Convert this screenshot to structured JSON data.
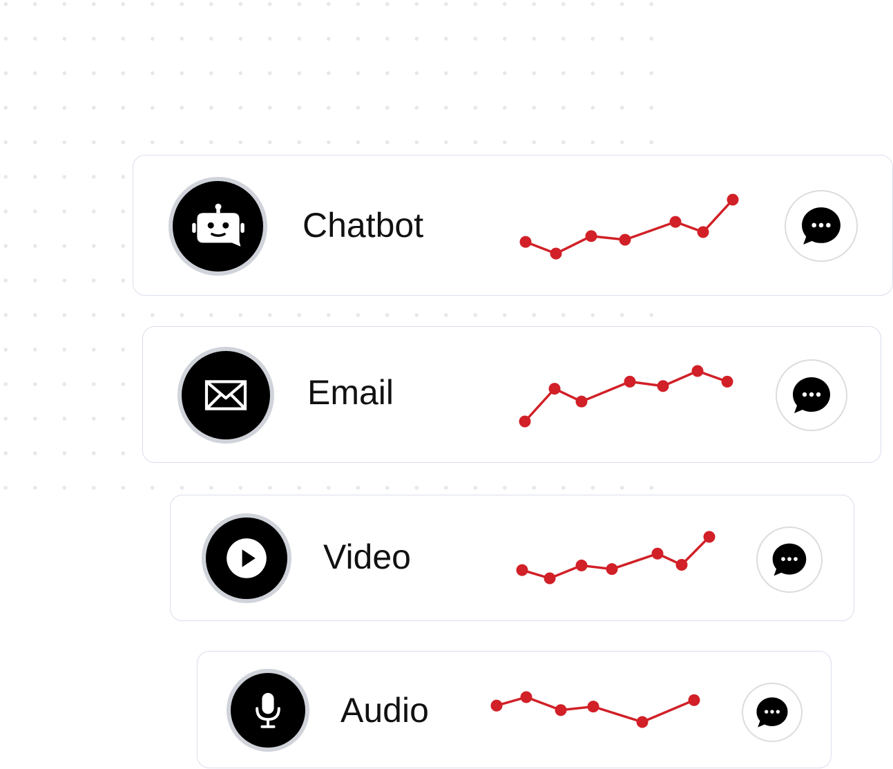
{
  "accent_color": "#d12027",
  "channels": [
    {
      "label": "Chatbot",
      "icon": "chatbot-icon",
      "action_icon": "chat-bubble-icon",
      "trend": [
        0.32,
        0.0,
        0.48,
        0.38,
        0.87,
        0.59,
        1.48
      ]
    },
    {
      "label": "Email",
      "icon": "envelope-icon",
      "action_icon": "chat-bubble-icon",
      "trend": [
        0.0,
        0.74,
        0.45,
        0.9,
        0.8,
        1.14,
        0.9
      ]
    },
    {
      "label": "Video",
      "icon": "play-icon",
      "action_icon": "chat-bubble-icon",
      "trend": [
        0.25,
        0.0,
        0.39,
        0.28,
        0.75,
        0.41,
        1.26
      ]
    },
    {
      "label": "Audio",
      "icon": "microphone-icon",
      "action_icon": "chat-bubble-icon",
      "trend": [
        0.66,
        1.0,
        0.48,
        0.62,
        0.0,
        0.88
      ]
    }
  ]
}
